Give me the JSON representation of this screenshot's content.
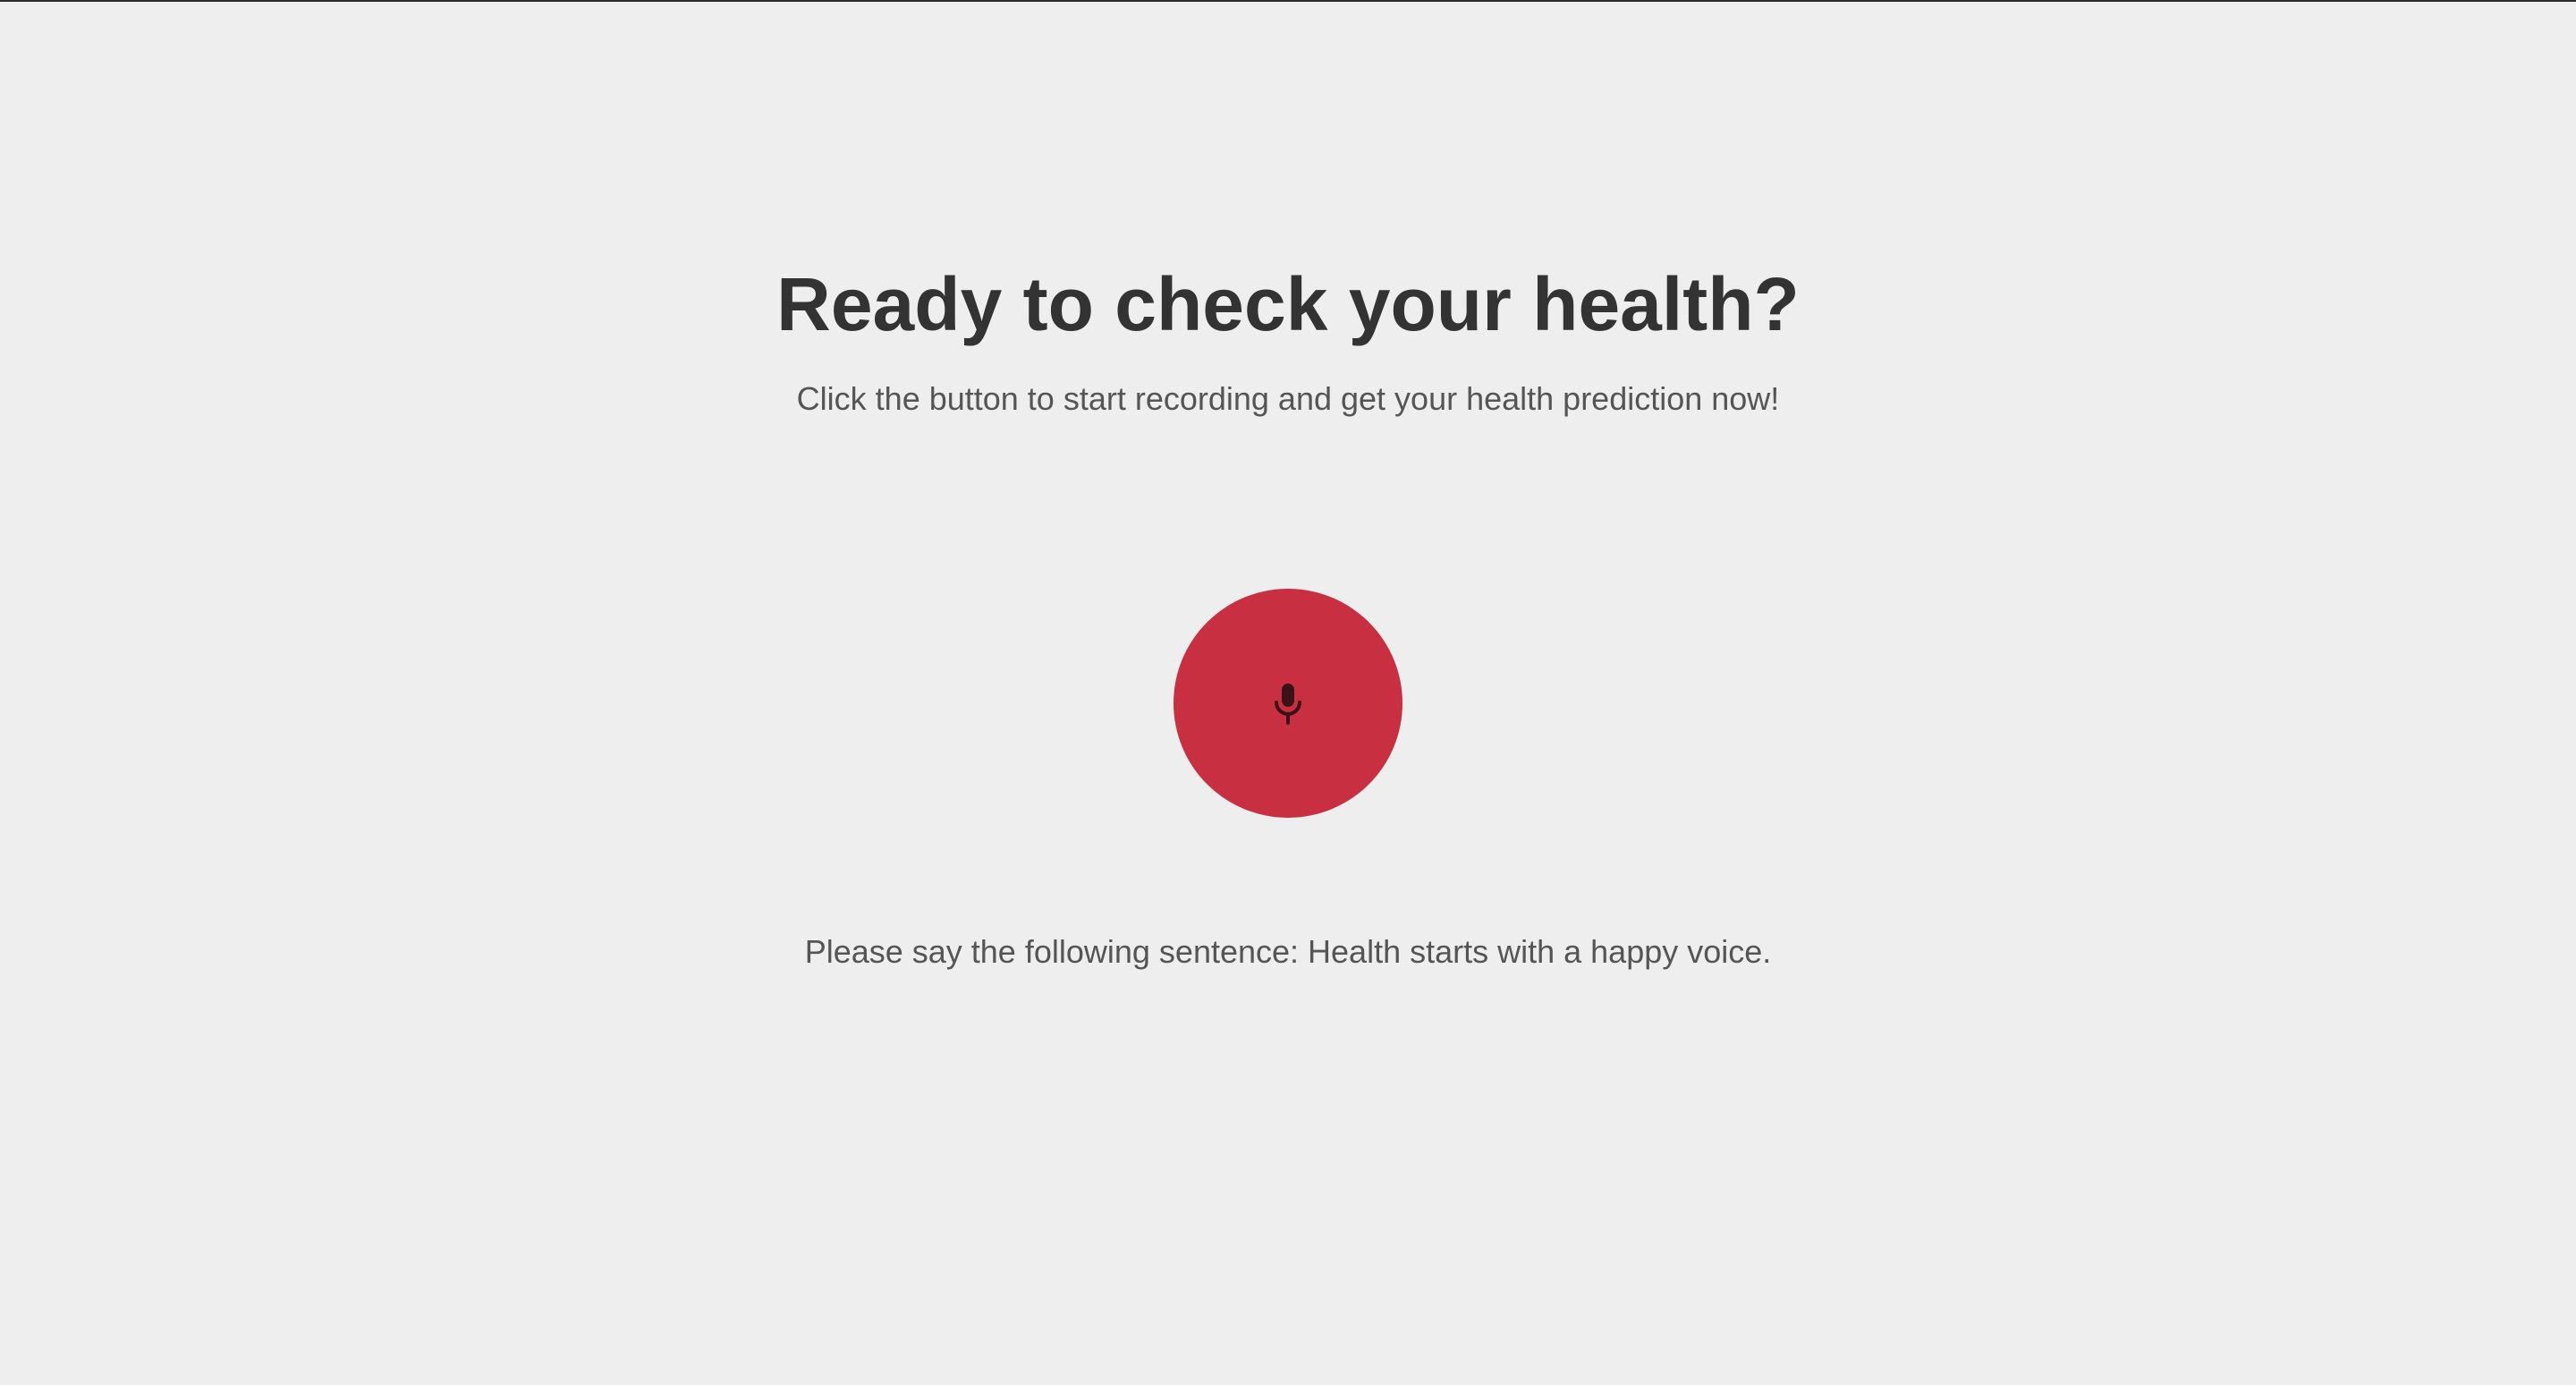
{
  "hero": {
    "title": "Ready to check your health?",
    "subtitle": "Click the button to start recording and get your health prediction now!"
  },
  "record_button": {
    "icon": "microphone-icon",
    "color": "#c83042",
    "icon_color": "#3a1318"
  },
  "instruction": {
    "text": "Please say the following sentence: Health starts with a happy voice."
  },
  "colors": {
    "background": "#eeeeee",
    "title": "#333333",
    "body_text": "#555555"
  }
}
